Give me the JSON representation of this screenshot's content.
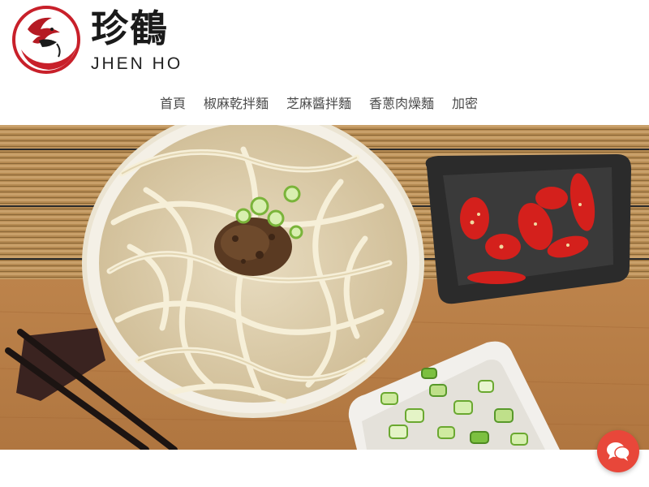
{
  "brand": {
    "name_zh": "珍鶴",
    "name_en": "JHEN HO",
    "accent_color": "#c8202a"
  },
  "nav": {
    "items": [
      {
        "label": "首頁"
      },
      {
        "label": "椒麻乾拌麵"
      },
      {
        "label": "芝麻醬拌麵"
      },
      {
        "label": "香蔥肉燥麵"
      },
      {
        "label": "加密"
      }
    ]
  },
  "hero": {
    "icon": "noodle-bowl-photo"
  },
  "chat": {
    "icon": "chat-bubbles-icon",
    "color": "#e8473a"
  }
}
